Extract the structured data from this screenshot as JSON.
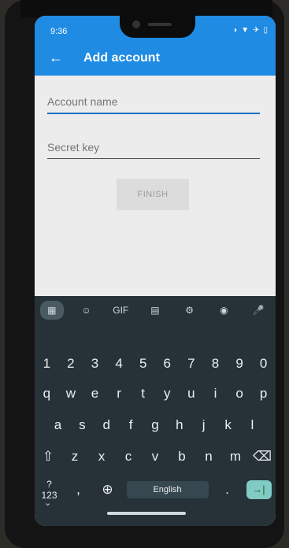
{
  "status_bar": {
    "time": "9:36",
    "icons": [
      "vibrate-icon",
      "wifi-icon",
      "airplane-icon",
      "battery-icon"
    ]
  },
  "app_bar": {
    "back_icon": "back-arrow-icon",
    "title": "Add account",
    "color": "#1f8be3"
  },
  "form": {
    "account_name": {
      "placeholder": "Account name",
      "value": ""
    },
    "secret_key": {
      "placeholder": "Secret key",
      "value": ""
    },
    "finish_label": "FINISH"
  },
  "keyboard": {
    "toolbar": [
      "apps-grid-icon",
      "sticker-icon",
      "GIF",
      "clipboard-icon",
      "gear-icon",
      "palette-icon",
      "mic-icon"
    ],
    "gif_label": "GIF",
    "number_row": [
      "1",
      "2",
      "3",
      "4",
      "5",
      "6",
      "7",
      "8",
      "9",
      "0"
    ],
    "row1": [
      "q",
      "w",
      "e",
      "r",
      "t",
      "y",
      "u",
      "i",
      "o",
      "p"
    ],
    "row2": [
      "a",
      "s",
      "d",
      "f",
      "g",
      "h",
      "j",
      "k",
      "l"
    ],
    "row3": [
      "z",
      "x",
      "c",
      "v",
      "b",
      "n",
      "m"
    ],
    "symbols_label": "?123",
    "comma": ",",
    "space_label": "English",
    "period": ".",
    "enter_icon": "tab-arrow-icon"
  }
}
